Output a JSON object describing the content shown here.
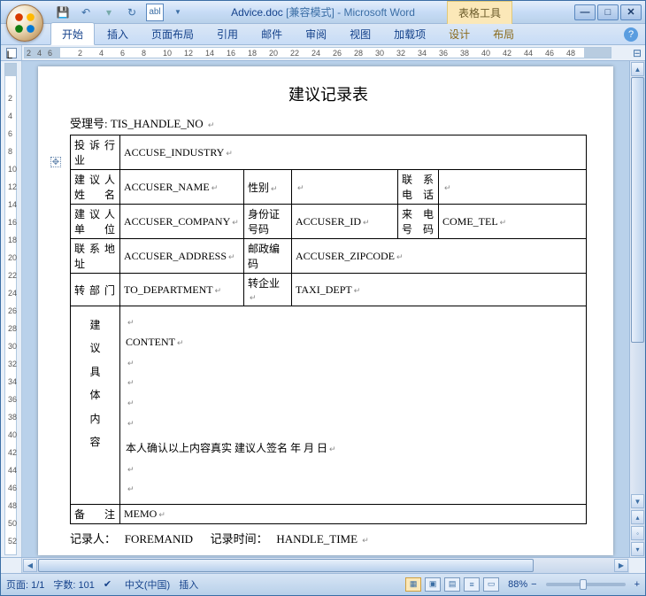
{
  "title": {
    "doc": "Advice.doc",
    "mode": "[兼容模式]",
    "app": "Microsoft Word",
    "context_tab": "表格工具"
  },
  "qat": {
    "save": "save-icon",
    "undo": "undo-icon",
    "redo": "redo-icon",
    "textbox": "abl"
  },
  "ribbon": {
    "tabs": [
      "开始",
      "插入",
      "页面布局",
      "引用",
      "邮件",
      "审阅",
      "视图",
      "加载项",
      "设计",
      "布局"
    ],
    "active_index": 0
  },
  "ruler": {
    "h_marks": [
      "2",
      "4",
      "6",
      "2",
      "4",
      "6",
      "8",
      "10",
      "12",
      "14",
      "16",
      "18",
      "20",
      "22",
      "24",
      "26",
      "28",
      "30",
      "32",
      "34",
      "36",
      "38",
      "40",
      "42",
      "44",
      "46",
      "48"
    ]
  },
  "document": {
    "title": "建议记录表",
    "accept_label": "受理号:",
    "accept_value": "TIS_HANDLE_NO",
    "rows": {
      "r1_lbl": "投诉行业",
      "r1_val": "ACCUSE_INDUSTRY",
      "r2_lbl": "建议人姓名",
      "r2_val": "ACCUSER_NAME",
      "r2_lbl2": "性别",
      "r2_lbl3": "联系电话",
      "r3_lbl": "建议人单位",
      "r3_val": "ACCUSER_COMPANY",
      "r3_lbl2": "身份证号码",
      "r3_val2": "ACCUSER_ID",
      "r3_lbl3": "来电号码",
      "r3_val3": "COME_TEL",
      "r4_lbl": "联系地址",
      "r4_val": "ACCUSER_ADDRESS",
      "r4_lbl2": "邮政编码",
      "r4_val2": "ACCUSER_ZIPCODE",
      "r5_lbl": "转部门",
      "r5_val": "TO_DEPARTMENT",
      "r5_lbl2": "转企业",
      "r5_val2": "TAXI_DEPT",
      "r6_lbl": "建议具体内容",
      "r6_content": "CONTENT",
      "r6_confirm": "本人确认以上内容真实        建议人签名                        年     月     日",
      "r7_lbl": "备注",
      "r7_val": "MEMO"
    },
    "footer": {
      "recorder_lbl": "记录人：",
      "recorder_val": "FOREMANID",
      "time_lbl": "记录时间：",
      "time_val": "HANDLE_TIME"
    }
  },
  "status": {
    "page": "页面: 1/1",
    "words": "字数: 101",
    "language": "中文(中国)",
    "mode": "插入",
    "zoom": "88%"
  }
}
